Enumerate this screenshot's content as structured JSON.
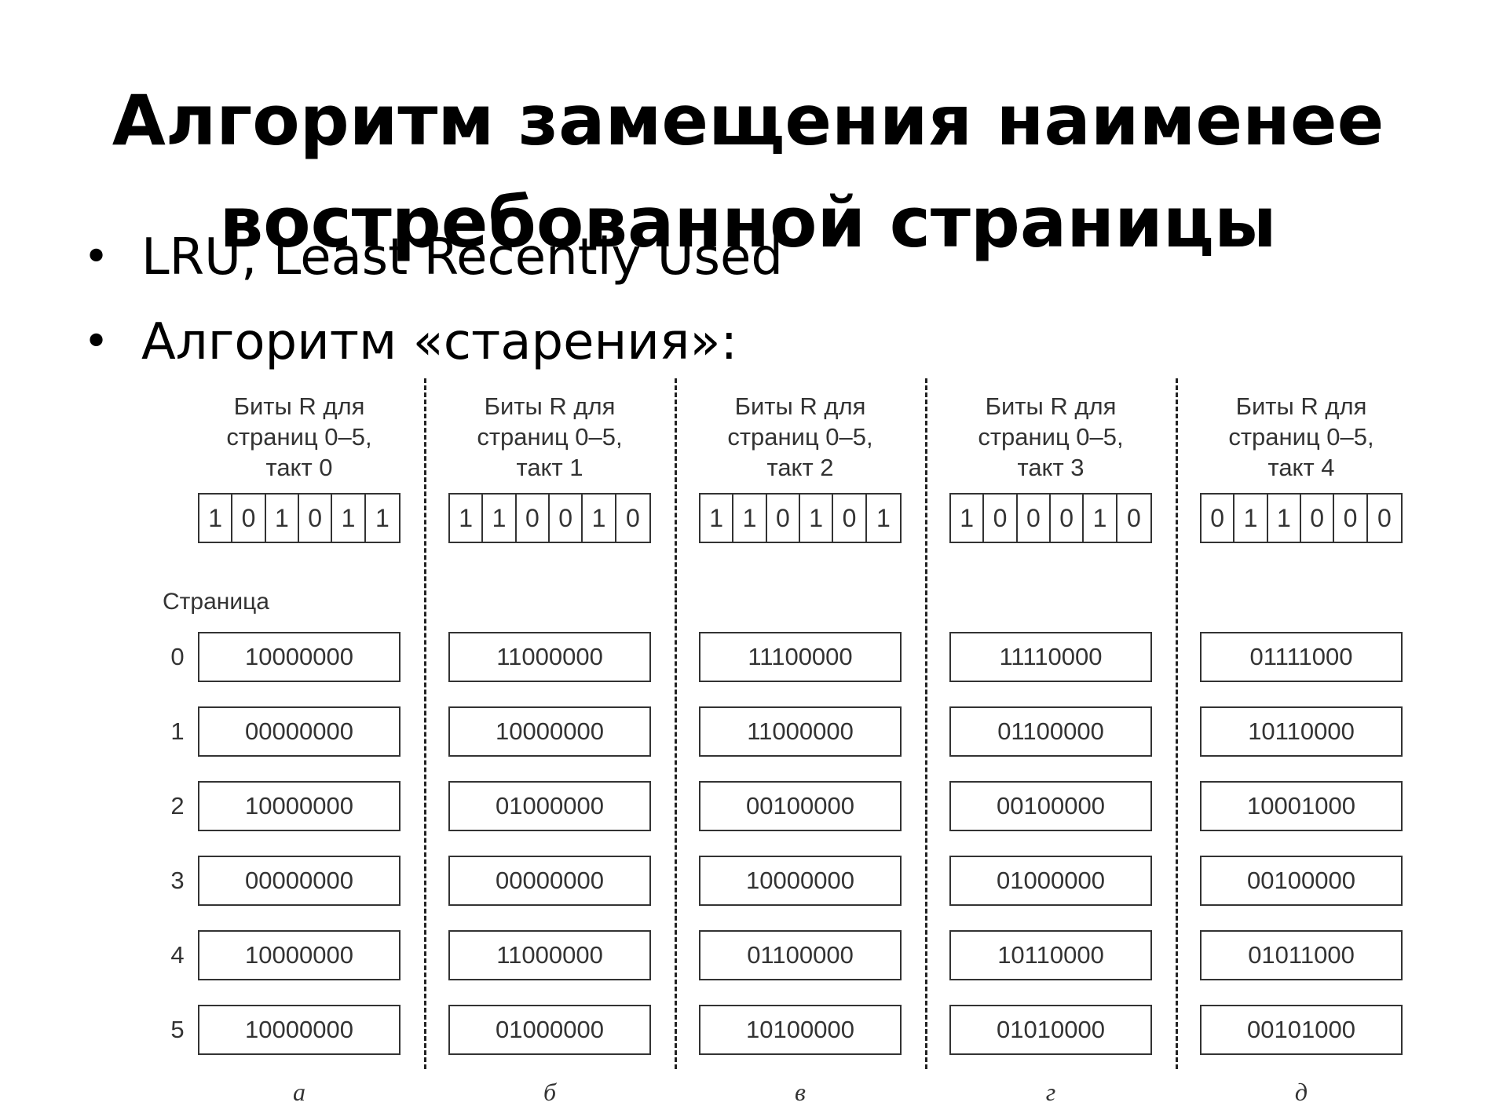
{
  "slide": {
    "title_lines": [
      "Алгоритм замещения наименее",
      "востребованной страницы"
    ],
    "bullets": [
      "LRU, Least Recently Used",
      "Алгоритм «старения»:"
    ],
    "bullet_symbol": "•"
  },
  "figure": {
    "page_caption": "Страница",
    "pages": [
      "0",
      "1",
      "2",
      "3",
      "4",
      "5"
    ],
    "columns": [
      {
        "header": [
          "Биты R для",
          "страниц 0–5,",
          "такт 0"
        ],
        "r_bits": [
          "1",
          "0",
          "1",
          "0",
          "1",
          "1"
        ],
        "counters": [
          "10000000",
          "00000000",
          "10000000",
          "00000000",
          "10000000",
          "10000000"
        ],
        "letter": "а"
      },
      {
        "header": [
          "Биты R для",
          "страниц 0–5,",
          "такт 1"
        ],
        "r_bits": [
          "1",
          "1",
          "0",
          "0",
          "1",
          "0"
        ],
        "counters": [
          "11000000",
          "10000000",
          "01000000",
          "00000000",
          "11000000",
          "01000000"
        ],
        "letter": "б"
      },
      {
        "header": [
          "Биты R для",
          "страниц 0–5,",
          "такт 2"
        ],
        "r_bits": [
          "1",
          "1",
          "0",
          "1",
          "0",
          "1"
        ],
        "counters": [
          "11100000",
          "11000000",
          "00100000",
          "10000000",
          "01100000",
          "10100000"
        ],
        "letter": "в"
      },
      {
        "header": [
          "Биты R для",
          "страниц 0–5,",
          "такт 3"
        ],
        "r_bits": [
          "1",
          "0",
          "0",
          "0",
          "1",
          "0"
        ],
        "counters": [
          "11110000",
          "01100000",
          "00100000",
          "01000000",
          "10110000",
          "01010000"
        ],
        "letter": "г"
      },
      {
        "header": [
          "Биты R для",
          "страниц 0–5,",
          "такт 4"
        ],
        "r_bits": [
          "0",
          "1",
          "1",
          "0",
          "0",
          "0"
        ],
        "counters": [
          "01111000",
          "10110000",
          "10001000",
          "00100000",
          "01011000",
          "00101000"
        ],
        "letter": "д"
      }
    ]
  }
}
